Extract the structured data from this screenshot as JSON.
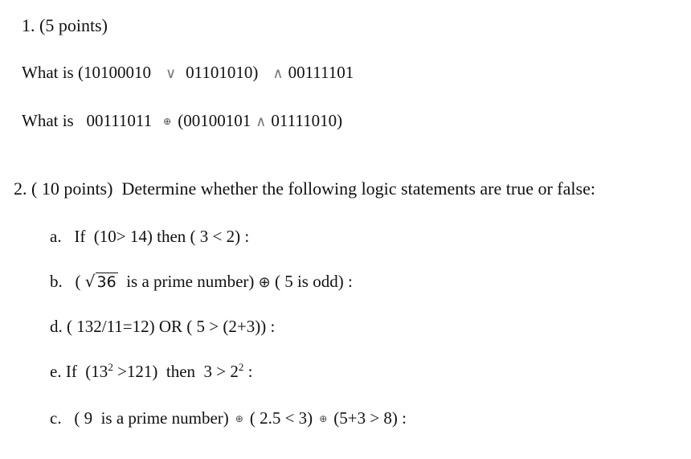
{
  "question1": {
    "heading": "1. (5 points)",
    "lines": [
      {
        "prefix": "What is (10100010",
        "op1": "∨",
        "mid": "01101010)",
        "op2": "∧",
        "suffix": "00111101"
      },
      {
        "prefix": "What is   00111011",
        "op1": "⊕",
        "mid": "(00100101",
        "op2": "∧",
        "suffix": "01111010)"
      }
    ]
  },
  "question2": {
    "heading": "2. ( 10 points)  Determine whether the following logic statements are true or false:",
    "items": {
      "a": {
        "text": "a.   If  (10> 14) then ( 3 < 2) :"
      },
      "b": {
        "prefix": "b.   ( ",
        "radical": "√",
        "radicand": "36",
        "mid": "  is a prime number) ",
        "op": "⊕",
        "suffix": " ( 5 is odd) :"
      },
      "d": {
        "text": "d. ( 132/11=12) OR ( 5 > (2+3)) :"
      },
      "e": {
        "p1": "e. If  (13",
        "sup1": "2",
        "p2": " >121)  then  3 > 2",
        "sup2": "2",
        "p3": " :"
      },
      "c": {
        "p1": "c.   ( 9  is a prime number)",
        "op1": "⊕",
        "p2": "( 2.5 < 3)",
        "op2": "⊕",
        "p3": "(5+3 > 8) :"
      }
    }
  }
}
